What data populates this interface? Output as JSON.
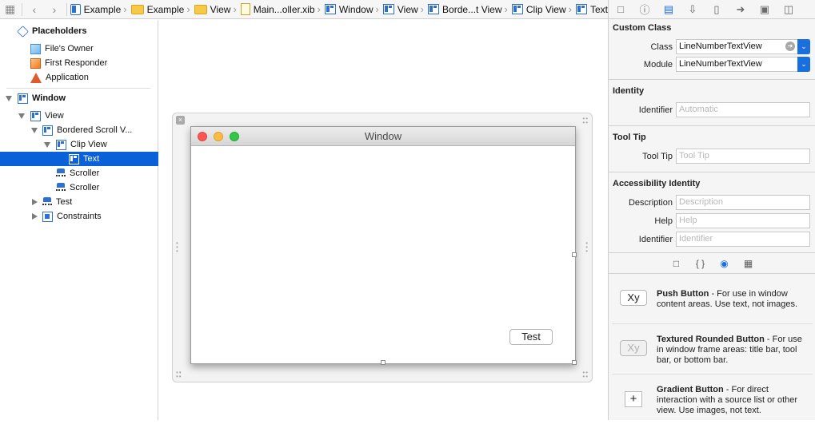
{
  "jumpbar": {
    "crumbs": [
      "Example",
      "Example",
      "View",
      "Main...oller.xib",
      "Window",
      "View",
      "Borde...t View",
      "Clip View",
      "Text"
    ]
  },
  "outline": {
    "placeholders_label": "Placeholders",
    "files_owner": "File's Owner",
    "first_responder": "First Responder",
    "application": "Application",
    "window": "Window",
    "view": "View",
    "bordered_scroll_view": "Bordered Scroll V...",
    "clip_view": "Clip View",
    "text": "Text",
    "scroller1": "Scroller",
    "scroller2": "Scroller",
    "test": "Test",
    "constraints": "Constraints"
  },
  "canvas": {
    "window_title": "Window",
    "test_button": "Test"
  },
  "inspector": {
    "custom_class": {
      "title": "Custom Class",
      "class_label": "Class",
      "class_value": "LineNumberTextView",
      "module_label": "Module",
      "module_value": "LineNumberTextView"
    },
    "identity": {
      "title": "Identity",
      "identifier_label": "Identifier",
      "identifier_placeholder": "Automatic"
    },
    "tooltip": {
      "title": "Tool Tip",
      "label": "Tool Tip",
      "placeholder": "Tool Tip"
    },
    "accessibility": {
      "title": "Accessibility Identity",
      "description_label": "Description",
      "description_placeholder": "Description",
      "help_label": "Help",
      "help_placeholder": "Help",
      "identifier_label": "Identifier",
      "identifier_placeholder": "Identifier"
    }
  },
  "library": {
    "items": [
      {
        "thumb": "Xy",
        "name": "Push Button",
        "desc": " - For use in window content areas. Use text, not images."
      },
      {
        "thumb": "Xy",
        "name": "Textured Rounded Button",
        "desc": " - For use in window frame areas: title bar, tool bar, or bottom bar."
      },
      {
        "thumb": "+",
        "name": "Gradient Button",
        "desc": " - For direct interaction with a source list or other view. Use images, not text."
      }
    ]
  }
}
